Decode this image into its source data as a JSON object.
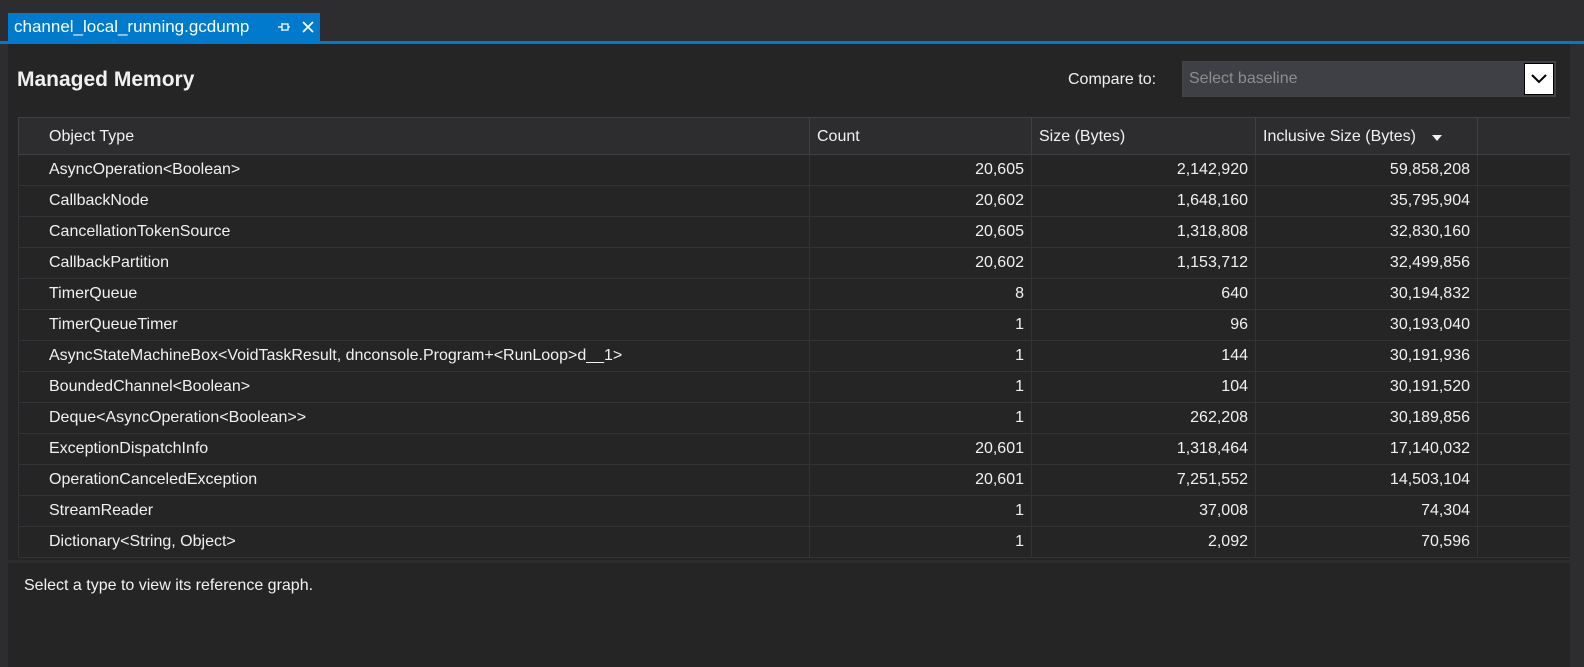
{
  "tab": {
    "title": "channel_local_running.gcdump",
    "pin_icon": "pin-icon",
    "close_icon": "close-icon"
  },
  "header": {
    "title": "Managed Memory",
    "compare_label": "Compare to:",
    "baseline_placeholder": "Select baseline"
  },
  "grid": {
    "columns": [
      "Object Type",
      "Count",
      "Size (Bytes)",
      "Inclusive Size (Bytes)"
    ],
    "sorted_column": "Inclusive Size (Bytes)",
    "rows": [
      {
        "type": "AsyncOperation<Boolean>",
        "count": "20,605",
        "size": "2,142,920",
        "inclusive": "59,858,208"
      },
      {
        "type": "CallbackNode",
        "count": "20,602",
        "size": "1,648,160",
        "inclusive": "35,795,904"
      },
      {
        "type": "CancellationTokenSource",
        "count": "20,605",
        "size": "1,318,808",
        "inclusive": "32,830,160"
      },
      {
        "type": "CallbackPartition",
        "count": "20,602",
        "size": "1,153,712",
        "inclusive": "32,499,856"
      },
      {
        "type": "TimerQueue",
        "count": "8",
        "size": "640",
        "inclusive": "30,194,832"
      },
      {
        "type": "TimerQueueTimer",
        "count": "1",
        "size": "96",
        "inclusive": "30,193,040"
      },
      {
        "type": "AsyncStateMachineBox<VoidTaskResult, dnconsole.Program+<RunLoop>d__1>",
        "count": "1",
        "size": "144",
        "inclusive": "30,191,936"
      },
      {
        "type": "BoundedChannel<Boolean>",
        "count": "1",
        "size": "104",
        "inclusive": "30,191,520"
      },
      {
        "type": "Deque<AsyncOperation<Boolean>>",
        "count": "1",
        "size": "262,208",
        "inclusive": "30,189,856"
      },
      {
        "type": "ExceptionDispatchInfo",
        "count": "20,601",
        "size": "1,318,464",
        "inclusive": "17,140,032"
      },
      {
        "type": "OperationCanceledException",
        "count": "20,601",
        "size": "7,251,552",
        "inclusive": "14,503,104"
      },
      {
        "type": "StreamReader",
        "count": "1",
        "size": "37,008",
        "inclusive": "74,304"
      },
      {
        "type": "Dictionary<String, Object>",
        "count": "1",
        "size": "2,092",
        "inclusive": "70,596"
      }
    ]
  },
  "footer": {
    "info": "Select a type to view its reference graph."
  },
  "colors": {
    "accent": "#007acc",
    "background": "#252526",
    "chrome": "#2d2d30"
  }
}
